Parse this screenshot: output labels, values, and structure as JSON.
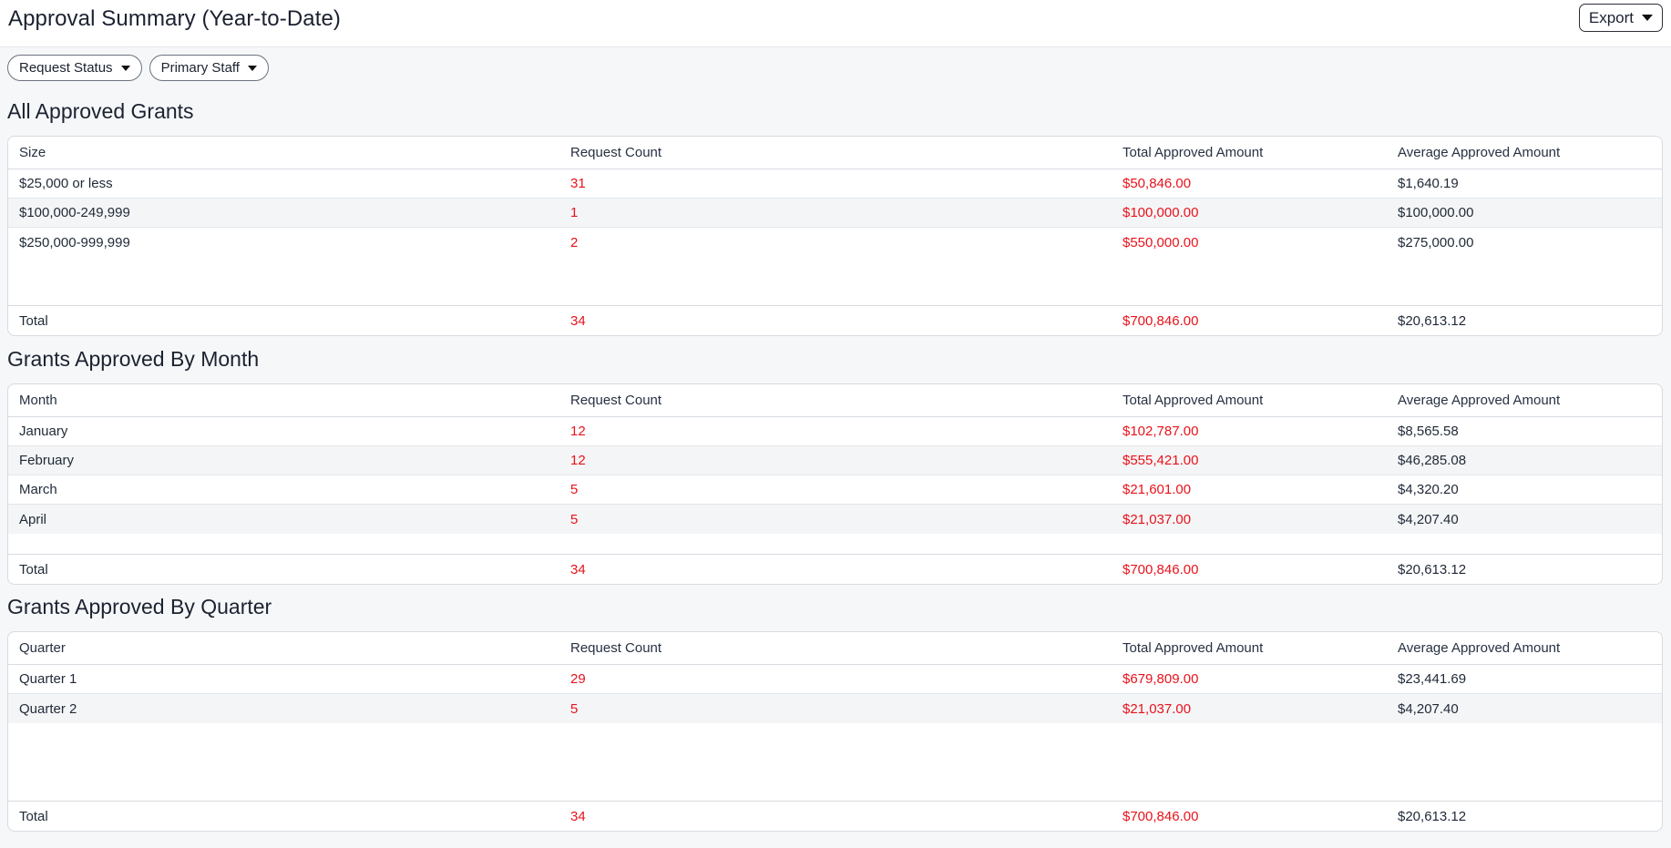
{
  "header": {
    "title": "Approval Summary (Year-to-Date)",
    "export_label": "Export"
  },
  "filters": [
    {
      "label": "Request Status"
    },
    {
      "label": "Primary Staff"
    }
  ],
  "colors": {
    "accent_red": "#e8121b",
    "border": "#d7dbe0",
    "background": "#f6f7f9"
  },
  "sections": [
    {
      "title": "All Approved Grants",
      "columns": [
        "Size",
        "Request Count",
        "Total Approved Amount",
        "Average Approved Amount"
      ],
      "rows": [
        [
          "$25,000 or less",
          "31",
          "$50,846.00",
          "$1,640.19"
        ],
        [
          "$100,000-249,999",
          "1",
          "$100,000.00",
          "$100,000.00"
        ],
        [
          "$250,000-999,999",
          "2",
          "$550,000.00",
          "$275,000.00"
        ]
      ],
      "total": [
        "Total",
        "34",
        "$700,846.00",
        "$20,613.12"
      ]
    },
    {
      "title": "Grants Approved By Month",
      "columns": [
        "Month",
        "Request Count",
        "Total Approved Amount",
        "Average Approved Amount"
      ],
      "rows": [
        [
          "January",
          "12",
          "$102,787.00",
          "$8,565.58"
        ],
        [
          "February",
          "12",
          "$555,421.00",
          "$46,285.08"
        ],
        [
          "March",
          "5",
          "$21,601.00",
          "$4,320.20"
        ],
        [
          "April",
          "5",
          "$21,037.00",
          "$4,207.40"
        ]
      ],
      "total": [
        "Total",
        "34",
        "$700,846.00",
        "$20,613.12"
      ]
    },
    {
      "title": "Grants Approved By Quarter",
      "columns": [
        "Quarter",
        "Request Count",
        "Total Approved Amount",
        "Average Approved Amount"
      ],
      "rows": [
        [
          "Quarter 1",
          "29",
          "$679,809.00",
          "$23,441.69"
        ],
        [
          "Quarter 2",
          "5",
          "$21,037.00",
          "$4,207.40"
        ]
      ],
      "total": [
        "Total",
        "34",
        "$700,846.00",
        "$20,613.12"
      ]
    }
  ]
}
